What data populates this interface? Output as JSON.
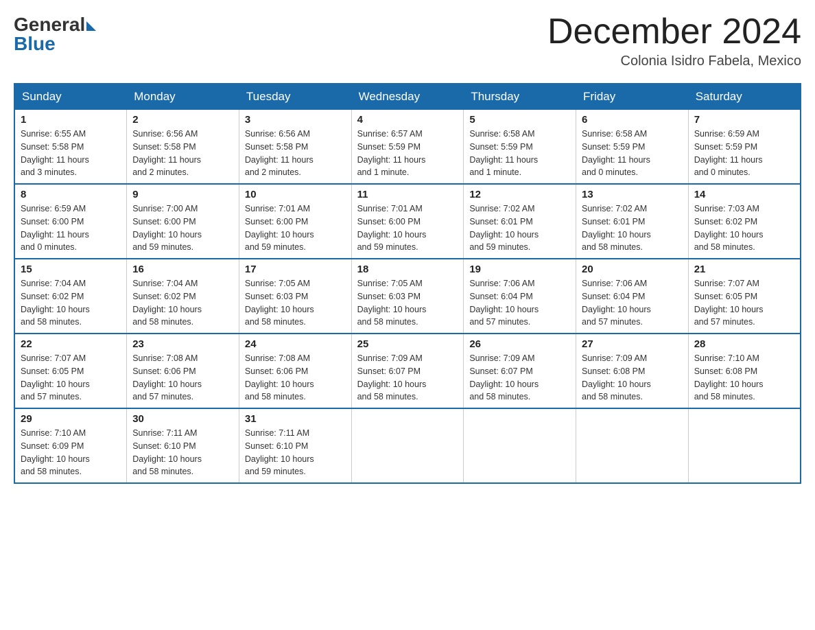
{
  "logo": {
    "general_text": "General",
    "blue_text": "Blue"
  },
  "title": {
    "month_year": "December 2024",
    "location": "Colonia Isidro Fabela, Mexico"
  },
  "days_of_week": [
    "Sunday",
    "Monday",
    "Tuesday",
    "Wednesday",
    "Thursday",
    "Friday",
    "Saturday"
  ],
  "weeks": [
    [
      {
        "day": "1",
        "sunrise": "6:55 AM",
        "sunset": "5:58 PM",
        "daylight": "11 hours and 3 minutes."
      },
      {
        "day": "2",
        "sunrise": "6:56 AM",
        "sunset": "5:58 PM",
        "daylight": "11 hours and 2 minutes."
      },
      {
        "day": "3",
        "sunrise": "6:56 AM",
        "sunset": "5:58 PM",
        "daylight": "11 hours and 2 minutes."
      },
      {
        "day": "4",
        "sunrise": "6:57 AM",
        "sunset": "5:59 PM",
        "daylight": "11 hours and 1 minute."
      },
      {
        "day": "5",
        "sunrise": "6:58 AM",
        "sunset": "5:59 PM",
        "daylight": "11 hours and 1 minute."
      },
      {
        "day": "6",
        "sunrise": "6:58 AM",
        "sunset": "5:59 PM",
        "daylight": "11 hours and 0 minutes."
      },
      {
        "day": "7",
        "sunrise": "6:59 AM",
        "sunset": "5:59 PM",
        "daylight": "11 hours and 0 minutes."
      }
    ],
    [
      {
        "day": "8",
        "sunrise": "6:59 AM",
        "sunset": "6:00 PM",
        "daylight": "11 hours and 0 minutes."
      },
      {
        "day": "9",
        "sunrise": "7:00 AM",
        "sunset": "6:00 PM",
        "daylight": "10 hours and 59 minutes."
      },
      {
        "day": "10",
        "sunrise": "7:01 AM",
        "sunset": "6:00 PM",
        "daylight": "10 hours and 59 minutes."
      },
      {
        "day": "11",
        "sunrise": "7:01 AM",
        "sunset": "6:00 PM",
        "daylight": "10 hours and 59 minutes."
      },
      {
        "day": "12",
        "sunrise": "7:02 AM",
        "sunset": "6:01 PM",
        "daylight": "10 hours and 59 minutes."
      },
      {
        "day": "13",
        "sunrise": "7:02 AM",
        "sunset": "6:01 PM",
        "daylight": "10 hours and 58 minutes."
      },
      {
        "day": "14",
        "sunrise": "7:03 AM",
        "sunset": "6:02 PM",
        "daylight": "10 hours and 58 minutes."
      }
    ],
    [
      {
        "day": "15",
        "sunrise": "7:04 AM",
        "sunset": "6:02 PM",
        "daylight": "10 hours and 58 minutes."
      },
      {
        "day": "16",
        "sunrise": "7:04 AM",
        "sunset": "6:02 PM",
        "daylight": "10 hours and 58 minutes."
      },
      {
        "day": "17",
        "sunrise": "7:05 AM",
        "sunset": "6:03 PM",
        "daylight": "10 hours and 58 minutes."
      },
      {
        "day": "18",
        "sunrise": "7:05 AM",
        "sunset": "6:03 PM",
        "daylight": "10 hours and 58 minutes."
      },
      {
        "day": "19",
        "sunrise": "7:06 AM",
        "sunset": "6:04 PM",
        "daylight": "10 hours and 57 minutes."
      },
      {
        "day": "20",
        "sunrise": "7:06 AM",
        "sunset": "6:04 PM",
        "daylight": "10 hours and 57 minutes."
      },
      {
        "day": "21",
        "sunrise": "7:07 AM",
        "sunset": "6:05 PM",
        "daylight": "10 hours and 57 minutes."
      }
    ],
    [
      {
        "day": "22",
        "sunrise": "7:07 AM",
        "sunset": "6:05 PM",
        "daylight": "10 hours and 57 minutes."
      },
      {
        "day": "23",
        "sunrise": "7:08 AM",
        "sunset": "6:06 PM",
        "daylight": "10 hours and 57 minutes."
      },
      {
        "day": "24",
        "sunrise": "7:08 AM",
        "sunset": "6:06 PM",
        "daylight": "10 hours and 58 minutes."
      },
      {
        "day": "25",
        "sunrise": "7:09 AM",
        "sunset": "6:07 PM",
        "daylight": "10 hours and 58 minutes."
      },
      {
        "day": "26",
        "sunrise": "7:09 AM",
        "sunset": "6:07 PM",
        "daylight": "10 hours and 58 minutes."
      },
      {
        "day": "27",
        "sunrise": "7:09 AM",
        "sunset": "6:08 PM",
        "daylight": "10 hours and 58 minutes."
      },
      {
        "day": "28",
        "sunrise": "7:10 AM",
        "sunset": "6:08 PM",
        "daylight": "10 hours and 58 minutes."
      }
    ],
    [
      {
        "day": "29",
        "sunrise": "7:10 AM",
        "sunset": "6:09 PM",
        "daylight": "10 hours and 58 minutes."
      },
      {
        "day": "30",
        "sunrise": "7:11 AM",
        "sunset": "6:10 PM",
        "daylight": "10 hours and 58 minutes."
      },
      {
        "day": "31",
        "sunrise": "7:11 AM",
        "sunset": "6:10 PM",
        "daylight": "10 hours and 59 minutes."
      },
      null,
      null,
      null,
      null
    ]
  ],
  "labels": {
    "sunrise": "Sunrise:",
    "sunset": "Sunset:",
    "daylight": "Daylight:"
  }
}
